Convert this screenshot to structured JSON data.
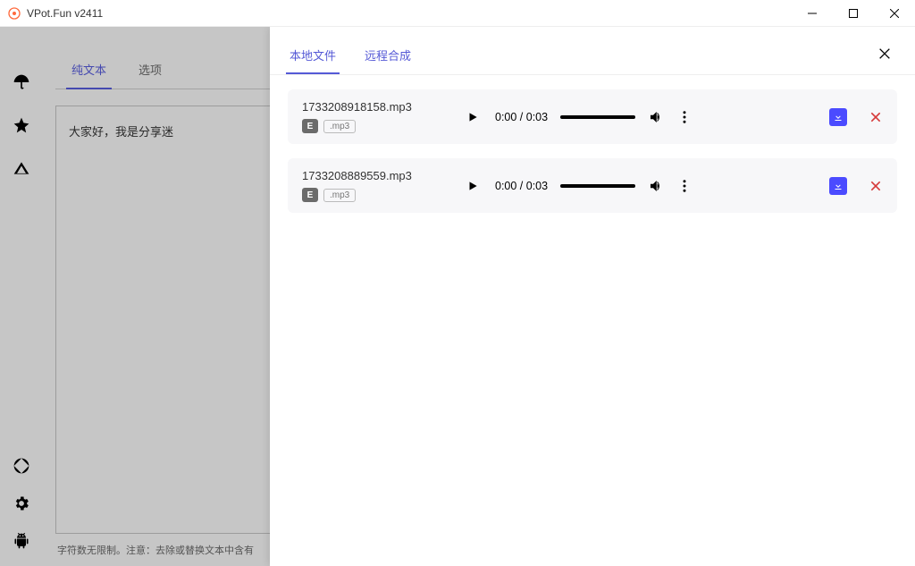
{
  "window": {
    "title": "VPot.Fun v2411"
  },
  "sidebar": {
    "top_icons": [
      "umbrella-icon",
      "star-icon",
      "triangle-icon"
    ],
    "bottom_icons": [
      "aperture-icon",
      "gear-icon",
      "android-icon"
    ]
  },
  "left_panel": {
    "tabs": [
      {
        "label": "纯文本",
        "active": true
      },
      {
        "label": "选项",
        "active": false
      }
    ],
    "text": "大家好，我是分享迷",
    "hint": "字符数无限制。注意：去除或替换文本中含有"
  },
  "modal": {
    "tabs": [
      {
        "label": "本地文件",
        "active": true
      },
      {
        "label": "远程合成",
        "active": false
      }
    ],
    "files": [
      {
        "name": "1733208918158.mp3",
        "badge_e": "E",
        "ext": ".mp3",
        "time": "0:00 / 0:03"
      },
      {
        "name": "1733208889559.mp3",
        "badge_e": "E",
        "ext": ".mp3",
        "time": "0:00 / 0:03"
      }
    ]
  }
}
